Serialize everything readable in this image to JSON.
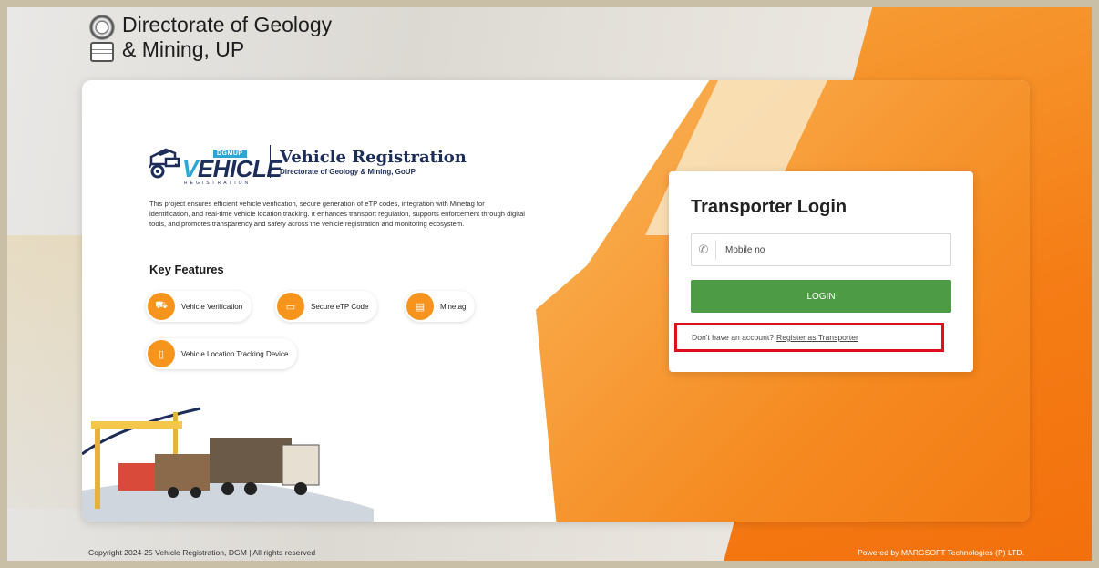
{
  "header": {
    "title_line1": "Directorate of Geology",
    "title_line2": "& Mining, UP",
    "emblem_icon": "state-emblem-icon"
  },
  "brand": {
    "tag": "DGMUP",
    "logo_word_v": "V",
    "logo_word_rest": "EHICLE",
    "logo_sub": "REGISTRATION",
    "title": "Vehicle Registration",
    "subtitle": "Directorate of Geology & Mining, GoUP"
  },
  "description": "This project ensures efficient vehicle verification, secure generation of eTP codes, integration with Minetag for identification, and real-time vehicle location tracking. It enhances transport regulation, supports enforcement through digital tools, and promotes transparency and safety across the vehicle registration and monitoring ecosystem.",
  "features": {
    "title": "Key Features",
    "items": [
      {
        "label": "Vehicle Verification",
        "icon": "vehicle-verification-icon"
      },
      {
        "label": "Secure eTP Code",
        "icon": "etp-code-icon"
      },
      {
        "label": "Minetag",
        "icon": "minetag-icon"
      },
      {
        "label": "Vehicle Location Tracking Device",
        "icon": "tracking-device-icon"
      }
    ]
  },
  "login": {
    "title": "Transporter Login",
    "mobile_placeholder": "Mobile no",
    "mobile_value": "",
    "button_label": "LOGIN",
    "register_prompt": "Don't have an account?",
    "register_link": "Register as Transporter"
  },
  "footer": {
    "copyright": "Copyright 2024-25 Vehicle Registration, DGM | All rights reserved",
    "powered_by": "Powered by MARGSOFT Technologies (P) LTD."
  },
  "colors": {
    "accent_orange": "#f7941d",
    "login_green": "#4e9b46",
    "highlight_red": "#e00d1b",
    "brand_navy": "#1c2d5a",
    "brand_blue": "#2aa7d7"
  }
}
